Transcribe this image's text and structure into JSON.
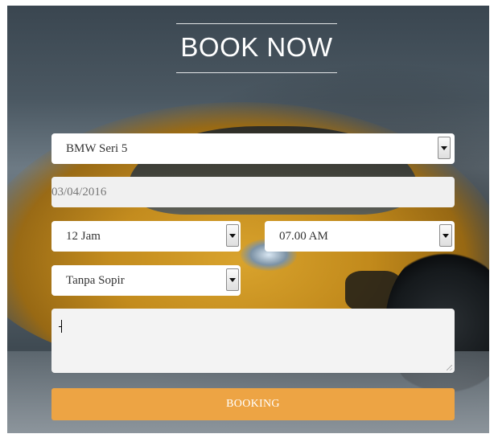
{
  "header": {
    "title": "BOOK NOW"
  },
  "form": {
    "car": {
      "value": "BMW Seri 5",
      "icon": "chevron-down-icon"
    },
    "date": {
      "value": "03/04/2016"
    },
    "duration": {
      "value": "12 Jam",
      "icon": "chevron-down-icon"
    },
    "time": {
      "value": "07.00 AM",
      "icon": "chevron-down-icon"
    },
    "driver": {
      "value": "Tanpa Sopir",
      "icon": "chevron-down-icon"
    },
    "notes": {
      "value": ""
    },
    "submit_label": "BOOKING"
  },
  "colors": {
    "button": "#eda444",
    "field_background": "#ffffff",
    "disabled_field_background": "#f0f0f0",
    "title_text": "#ffffff"
  }
}
